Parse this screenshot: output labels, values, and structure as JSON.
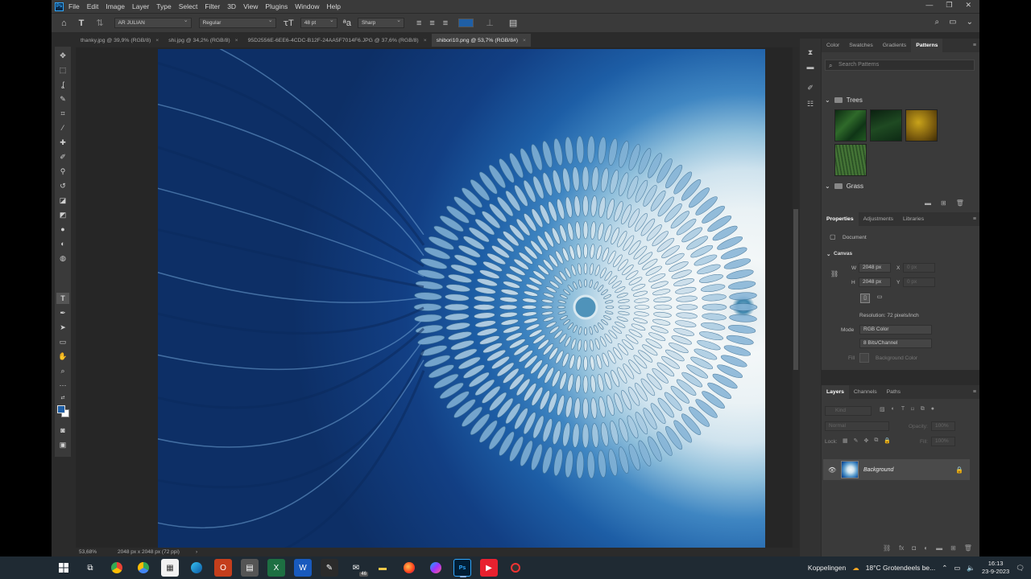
{
  "menubar": {
    "items": [
      "File",
      "Edit",
      "Image",
      "Layer",
      "Type",
      "Select",
      "Filter",
      "3D",
      "View",
      "Plugins",
      "Window",
      "Help"
    ]
  },
  "options": {
    "font_family": "AR JULIAN",
    "font_style": "Regular",
    "font_size": "48 pt",
    "antialias": "Sharp",
    "text_color": "#1f5fa6"
  },
  "tabs": [
    {
      "label": "thanky.jpg @ 39,9% (RGB/8)",
      "active": false
    },
    {
      "label": "shi.jpg @ 34,2% (RGB/8)",
      "active": false
    },
    {
      "label": "95D2556E-6EE6-4CDC-B12F-24AA5F7014F6.JPG @ 37,6% (RGB/8)",
      "active": false
    },
    {
      "label": "shibori10.png @ 53,7% (RGB/8#)",
      "active": true
    }
  ],
  "status": {
    "zoom": "53,68%",
    "doc_size": "2048 px x 2048 px (72 ppi)"
  },
  "patterns_panel": {
    "tabs": [
      "Color",
      "Swatches",
      "Gradients",
      "Patterns"
    ],
    "active_tab": "Patterns",
    "search_placeholder": "Search Patterns",
    "groups": [
      "Trees",
      "Grass"
    ]
  },
  "properties_panel": {
    "tabs": [
      "Properties",
      "Adjustments",
      "Libraries"
    ],
    "active_tab": "Properties",
    "doc_label": "Document",
    "section": "Canvas",
    "w_label": "W",
    "w_value": "2048 px",
    "h_label": "H",
    "h_value": "2048 px",
    "x_label": "X",
    "x_value": "0 px",
    "y_label": "Y",
    "y_value": "0 px",
    "resolution": "Resolution: 72 pixels/inch",
    "mode_label": "Mode",
    "mode_value": "RGB Color",
    "bits_value": "8 Bits/Channel",
    "fill_label": "Fill",
    "fill_value": "Background Color"
  },
  "layers_panel": {
    "tabs": [
      "Layers",
      "Channels",
      "Paths"
    ],
    "active_tab": "Layers",
    "filter_placeholder": "Kind",
    "blend_mode": "Normal",
    "opacity_label": "Opacity:",
    "opacity_value": "100%",
    "lock_label": "Lock:",
    "fill_label": "Fill:",
    "fill_value": "100%",
    "layer_name": "Background"
  },
  "taskbar": {
    "tray_label": "Koppelingen",
    "weather": "18°C  Grotendeels be...",
    "time": "16:13",
    "date": "23-9-2023",
    "mail_badge": "46"
  }
}
